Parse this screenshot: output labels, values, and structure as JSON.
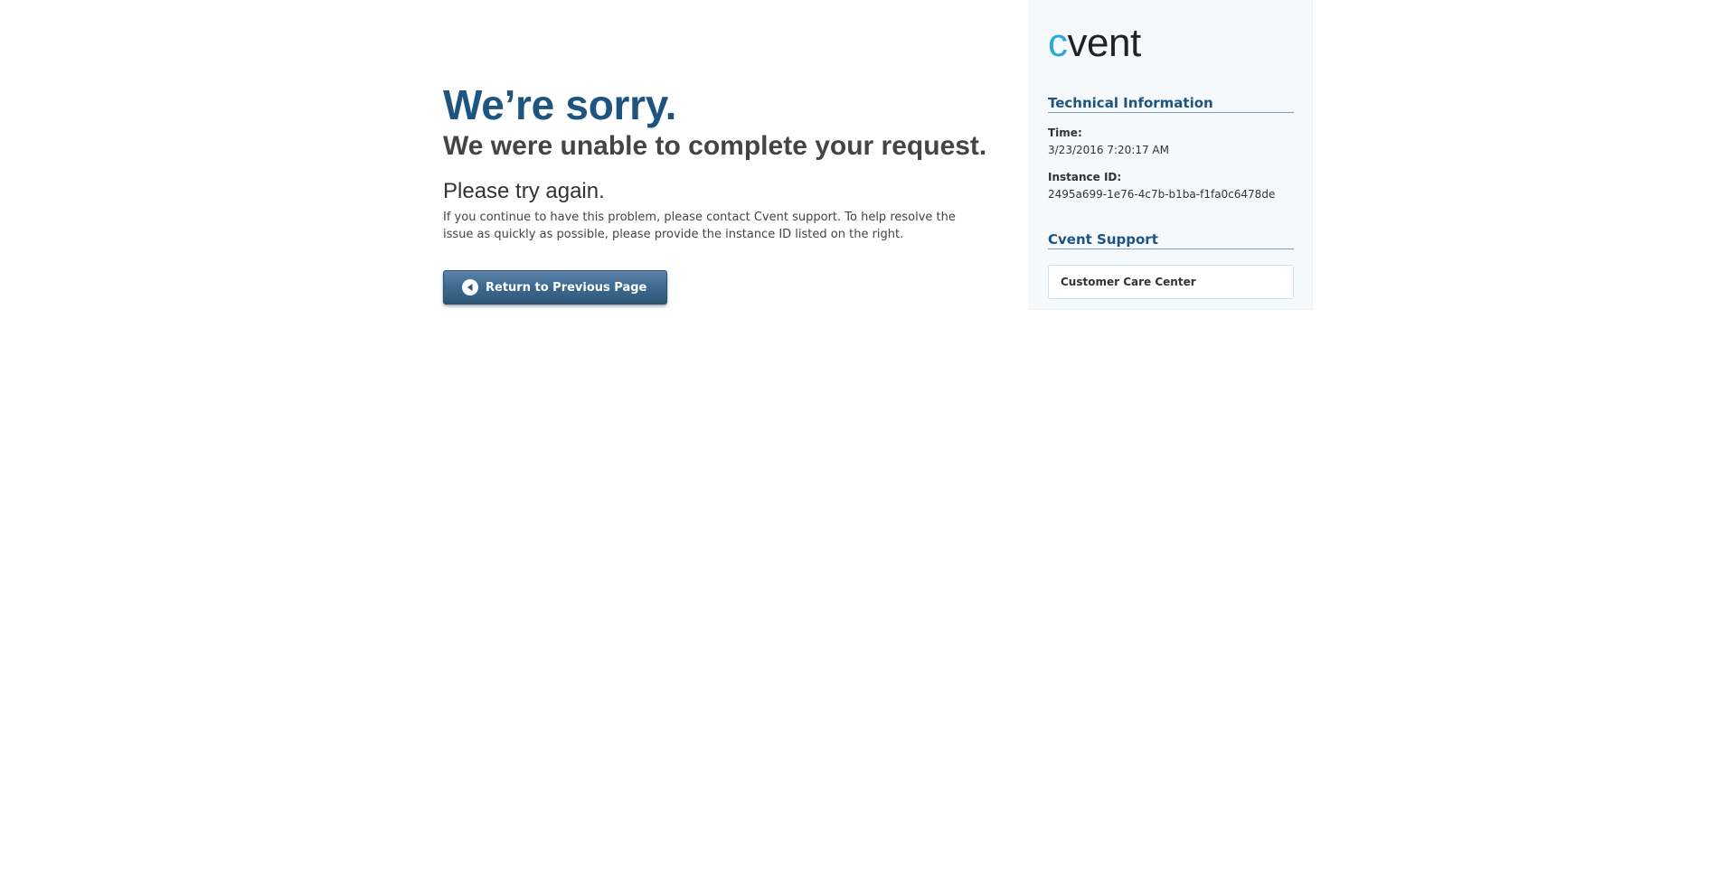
{
  "main": {
    "headline": "We’re sorry.",
    "subhead": "We were unable to complete your request.",
    "try_again": "Please try again.",
    "help_text": "If you continue to have this problem, please contact Cvent support. To help resolve the issue as quickly as possible, please provide the instance ID listed on the right.",
    "return_button": {
      "label": "Return to Previous Page",
      "icon": "back-arrow-circle-icon"
    }
  },
  "sidebar": {
    "logo": {
      "text": "cvent",
      "accent_letter": "c",
      "rest_letters": "vent",
      "accent_color": "#29a8e0",
      "text_color": "#222222"
    },
    "technical_information": {
      "heading": "Technical Information",
      "time_label": "Time:",
      "time_value": "3/23/2016 7:20:17 AM",
      "instance_label": "Instance ID:",
      "instance_value": "2495a699-1e76-4c7b-b1ba-f1fa0c6478de"
    },
    "support": {
      "heading": "Cvent Support",
      "link_label": "Customer Care Center"
    }
  },
  "colors": {
    "headline": "#1e5480",
    "button_top": "#5c84a8",
    "button_bottom": "#2e5678",
    "panel_background": "#f6f9fc"
  }
}
